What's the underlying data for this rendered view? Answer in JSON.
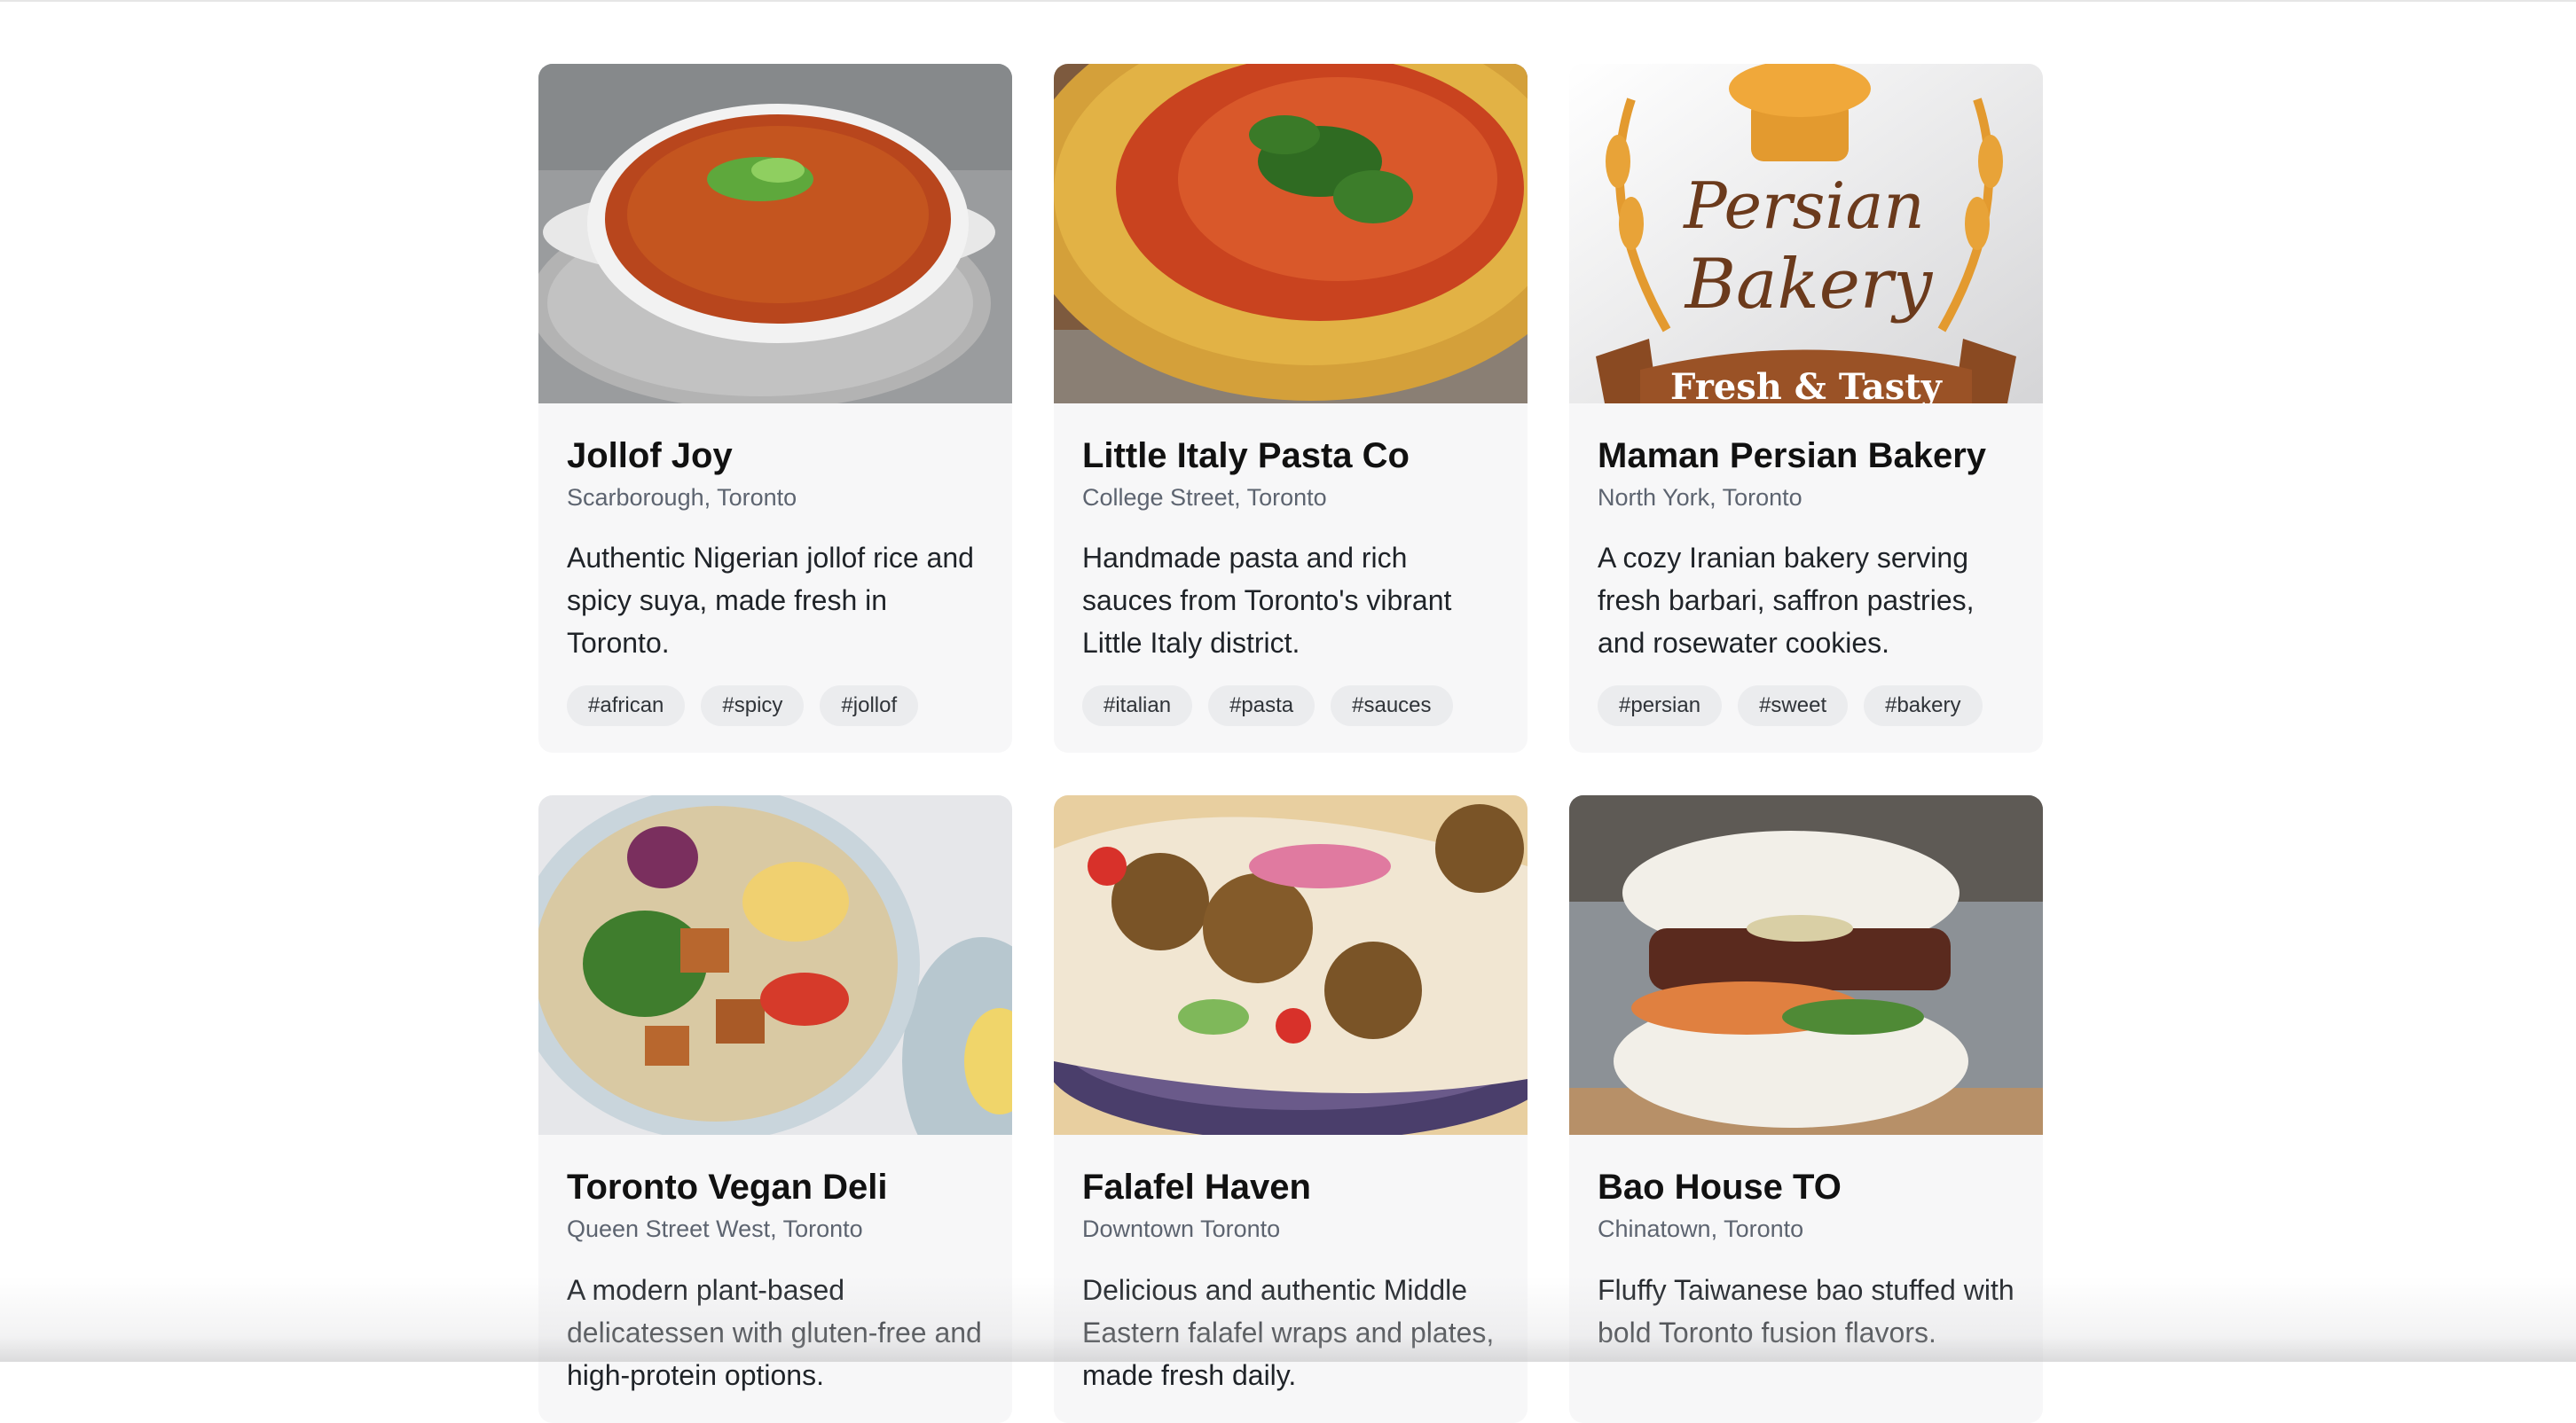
{
  "cards": [
    {
      "title": "Jollof Joy",
      "location": "Scarborough, Toronto",
      "description": "Authentic Nigerian jollof rice and spicy suya, made fresh in Toronto.",
      "tags": [
        "#african",
        "#spicy",
        "#jollof"
      ],
      "image": "jollof-rice-photo"
    },
    {
      "title": "Little Italy Pasta Co",
      "location": "College Street, Toronto",
      "description": "Handmade pasta and rich sauces from Toronto's vibrant Little Italy district.",
      "tags": [
        "#italian",
        "#pasta",
        "#sauces"
      ],
      "image": "penne-pasta-photo"
    },
    {
      "title": "Maman Persian Bakery",
      "location": "North York, Toronto",
      "description": "A cozy Iranian bakery serving fresh barbari, saffron pastries, and rosewater cookies.",
      "tags": [
        "#persian",
        "#sweet",
        "#bakery"
      ],
      "image": "persian-bakery-logo",
      "logo_text": [
        "Persian",
        "Bakery",
        "Fresh & Tasty"
      ]
    },
    {
      "title": "Toronto Vegan Deli",
      "location": "Queen Street West, Toronto",
      "description": "A modern plant-based delicatessen with gluten-free and high-protein options.",
      "tags": [],
      "image": "vegan-bowl-photo"
    },
    {
      "title": "Falafel Haven",
      "location": "Downtown Toronto",
      "description": "Delicious and authentic Middle Eastern falafel wraps and plates, made fresh daily.",
      "tags": [],
      "image": "falafel-wrap-photo"
    },
    {
      "title": "Bao House TO",
      "location": "Chinatown, Toronto",
      "description": "Fluffy Taiwanese bao stuffed with bold Toronto fusion flavors.",
      "tags": [],
      "image": "bao-bun-photo"
    }
  ],
  "colors": {
    "card_bg": "#f7f7f8",
    "tag_bg": "#ebecee",
    "title": "#111111",
    "location": "#5d6470"
  }
}
